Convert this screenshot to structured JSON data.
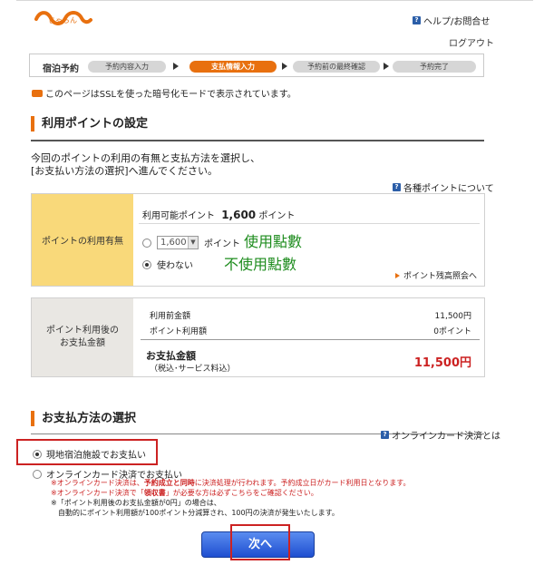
{
  "header": {
    "logo_text": "じゃらん",
    "help_label": "ヘルプ/お問合せ",
    "logout_label": "ログアウト"
  },
  "steps": {
    "label": "宿泊予約",
    "items": [
      {
        "label": "予約内容入力",
        "active": false
      },
      {
        "label": "支払情報入力",
        "active": true
      },
      {
        "label": "予約前の最終確認",
        "active": false
      },
      {
        "label": "予約完了",
        "active": false
      }
    ]
  },
  "ssl_notice": "このページはSSLを使った暗号化モードで表示されています。",
  "points_section": {
    "title": "利用ポイントの設定",
    "intro_line1": "今回のポイントの利用の有無と支払方法を選択し、",
    "intro_line2": "[お支払い方法の選択]へ進んでください。",
    "about_points_link": "各種ポイントについて",
    "usage_label": "ポイントの利用有無",
    "available_label": "利用可能ポイント",
    "available_value": "1,600",
    "available_unit": "ポイント",
    "use_select_value": "1,600",
    "use_unit": "ポイント",
    "not_use_label": "使わない",
    "annotation_use": "使用點數",
    "annotation_not_use": "不使用點數",
    "balance_link": "ポイント残高照会へ"
  },
  "summary": {
    "label_line1": "ポイント利用後の",
    "label_line2": "お支払金額",
    "before_label": "利用前金額",
    "before_value": "11,500円",
    "points_used_label": "ポイント利用額",
    "points_used_value": "0ポイント",
    "total_label": "お支払金額",
    "total_sub": "（税込･サービス料込）",
    "total_value": "11,500円"
  },
  "payment_section": {
    "title": "お支払方法の選択",
    "online_about_link": "オンラインカード決済とは",
    "option_onsite": "現地宿泊施設でお支払い",
    "option_online": "オンラインカード決済でお支払い",
    "note1_prefix": "※オンラインカード決済は、",
    "note1_bold": "予約成立と同時",
    "note1_suffix": "に決済処理が行われます。予約成立日がカード利用日となります。",
    "note2_prefix": "※オンラインカード決済で「",
    "note2_bold": "領収書",
    "note2_suffix": "」が必要な方は必ずこちらをご確認ください。",
    "note3": "※「ポイント利用後のお支払金額が0円」の場合は、",
    "note4": "自動的にポイント利用額が100ポイント分減算され、100円の決済が発生いたします。"
  },
  "next_button_label": "次へ",
  "colors": {
    "accent_orange": "#e8700f",
    "yellow_label": "#f9d97a",
    "annotation_green": "#1e8c1e",
    "highlight_red": "#cc2222",
    "button_blue": "#1f4fd0"
  }
}
